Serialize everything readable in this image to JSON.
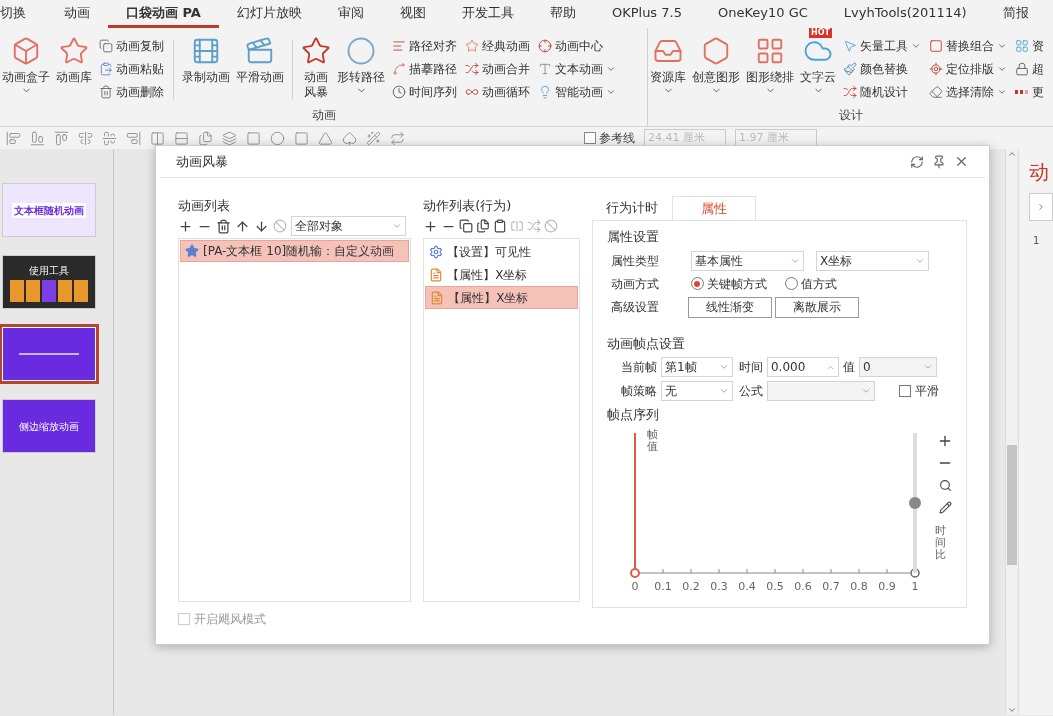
{
  "ribbon_tabs": [
    {
      "label": "切换",
      "selected": false
    },
    {
      "label": "动画",
      "selected": false
    },
    {
      "label": "口袋动画 PA",
      "selected": true
    },
    {
      "label": "幻灯片放映",
      "selected": false
    },
    {
      "label": "审阅",
      "selected": false
    },
    {
      "label": "视图",
      "selected": false
    },
    {
      "label": "开发工具",
      "selected": false
    },
    {
      "label": "帮助",
      "selected": false
    },
    {
      "label": "OKPlus 7.5",
      "selected": false
    },
    {
      "label": "OneKey10 GC",
      "selected": false
    },
    {
      "label": "LvyhTools(201114)",
      "selected": false
    },
    {
      "label": "简报",
      "selected": false
    }
  ],
  "ribbon_groups": [
    {
      "label": "动画",
      "sections": [
        {
          "kind": "big",
          "items": [
            {
              "label": "动画盒子",
              "caret": true
            },
            {
              "label": "动画库",
              "caret": false
            }
          ]
        },
        {
          "kind": "small",
          "items": [
            {
              "label": "动画复制",
              "caret": false
            },
            {
              "label": "动画粘贴",
              "caret": false
            },
            {
              "label": "动画删除",
              "caret": false
            }
          ]
        },
        {
          "kind": "divider"
        },
        {
          "kind": "big",
          "items": [
            {
              "label": "录制动画",
              "caret": false
            },
            {
              "label": "平滑动画",
              "caret": false
            }
          ]
        },
        {
          "kind": "divider"
        },
        {
          "kind": "big",
          "items": [
            {
              "label": "动画风暴",
              "caret": false,
              "narrow": true
            },
            {
              "label": "形转路径",
              "caret": true
            }
          ]
        },
        {
          "kind": "small",
          "items": [
            {
              "label": "路径对齐",
              "caret": false
            },
            {
              "label": "描摹路径",
              "caret": false
            },
            {
              "label": "时间序列",
              "caret": false
            }
          ]
        },
        {
          "kind": "small",
          "items": [
            {
              "label": "经典动画",
              "caret": false
            },
            {
              "label": "动画合并",
              "caret": false
            },
            {
              "label": "动画循环",
              "caret": false
            }
          ]
        },
        {
          "kind": "small",
          "items": [
            {
              "label": "动画中心",
              "caret": false
            },
            {
              "label": "文本动画",
              "caret": true
            },
            {
              "label": "智能动画",
              "caret": true
            }
          ]
        }
      ]
    },
    {
      "label": "设计",
      "sections": [
        {
          "kind": "big",
          "items": [
            {
              "label": "资源库",
              "caret": true
            },
            {
              "label": "创意图形",
              "caret": true
            },
            {
              "label": "图形绕排",
              "caret": true
            },
            {
              "label": "文字云",
              "caret": true,
              "badge": "HOT"
            }
          ]
        },
        {
          "kind": "small",
          "items": [
            {
              "label": "矢量工具",
              "caret": true
            },
            {
              "label": "颜色替换",
              "caret": false
            },
            {
              "label": "随机设计",
              "caret": false
            }
          ]
        },
        {
          "kind": "small",
          "items": [
            {
              "label": "替换组合",
              "caret": true
            },
            {
              "label": "定位排版",
              "caret": true
            },
            {
              "label": "选择清除",
              "caret": true
            }
          ]
        },
        {
          "kind": "small",
          "items": [
            {
              "label": "资",
              "caret": false
            },
            {
              "label": "超",
              "caret": false
            },
            {
              "label": "更",
              "caret": false
            }
          ]
        }
      ]
    }
  ],
  "toolbar": {
    "guides": {
      "label": "参考线",
      "checked": false
    },
    "width": "24.41 厘米",
    "height": "1.97 厘米"
  },
  "slides": [
    {
      "title": "文本框随机动画",
      "selected": false,
      "kind": "pattern"
    },
    {
      "title": "使用工具",
      "selected": false,
      "kind": "cards"
    },
    {
      "selected": true,
      "kind": "plain"
    },
    {
      "title": "侧边缩放动画",
      "selected": false,
      "kind": "plain"
    }
  ],
  "editor_side": {
    "heading": "动",
    "number": "1"
  },
  "dialog": {
    "title": "动画风暴",
    "animation_list": {
      "heading": "动画列表",
      "filter": "全部对象",
      "items": [
        {
          "label": "[PA-文本框 10]随机输：自定义动画",
          "selected": true
        }
      ]
    },
    "action_list": {
      "heading": "动作列表(行为)",
      "items": [
        {
          "label": "【设置】可见性",
          "kind": "setting",
          "selected": false
        },
        {
          "label": "【属性】X坐标",
          "kind": "property",
          "selected": false
        },
        {
          "label": "【属性】X坐标",
          "kind": "property",
          "selected": true
        }
      ]
    },
    "tabs": [
      {
        "label": "行为计时",
        "selected": false
      },
      {
        "label": "属性",
        "selected": true
      }
    ],
    "properties": {
      "heading": "属性设置",
      "type_label": "属性类型",
      "type_value": "基本属性",
      "property_value": "X坐标",
      "mode_label": "动画方式",
      "modes": [
        {
          "label": "关键帧方式",
          "selected": true
        },
        {
          "label": "值方式",
          "selected": false
        }
      ],
      "advanced_label": "高级设置",
      "advanced_buttons": [
        "线性渐变",
        "离散展示"
      ]
    },
    "keyframes": {
      "heading": "动画帧点设置",
      "current_label": "当前帧",
      "current_value": "第1帧",
      "time_label": "时间",
      "time_value": "0.000",
      "value_label": "值",
      "value_value": "0",
      "strategy_label": "帧策略",
      "strategy_value": "无",
      "formula_label": "公式",
      "smooth": {
        "label": "平滑",
        "checked": false
      }
    },
    "sequence": {
      "heading": "帧点序列",
      "y_label": "帧值",
      "x_label": "时间比",
      "ticks": [
        "0",
        "0.1",
        "0.2",
        "0.3",
        "0.4",
        "0.5",
        "0.6",
        "0.7",
        "0.8",
        "0.9",
        "1"
      ],
      "zoom": {
        "level": 0.5
      }
    },
    "hurricane": {
      "label": "开启飓风模式",
      "checked": false,
      "disabled": true
    }
  }
}
